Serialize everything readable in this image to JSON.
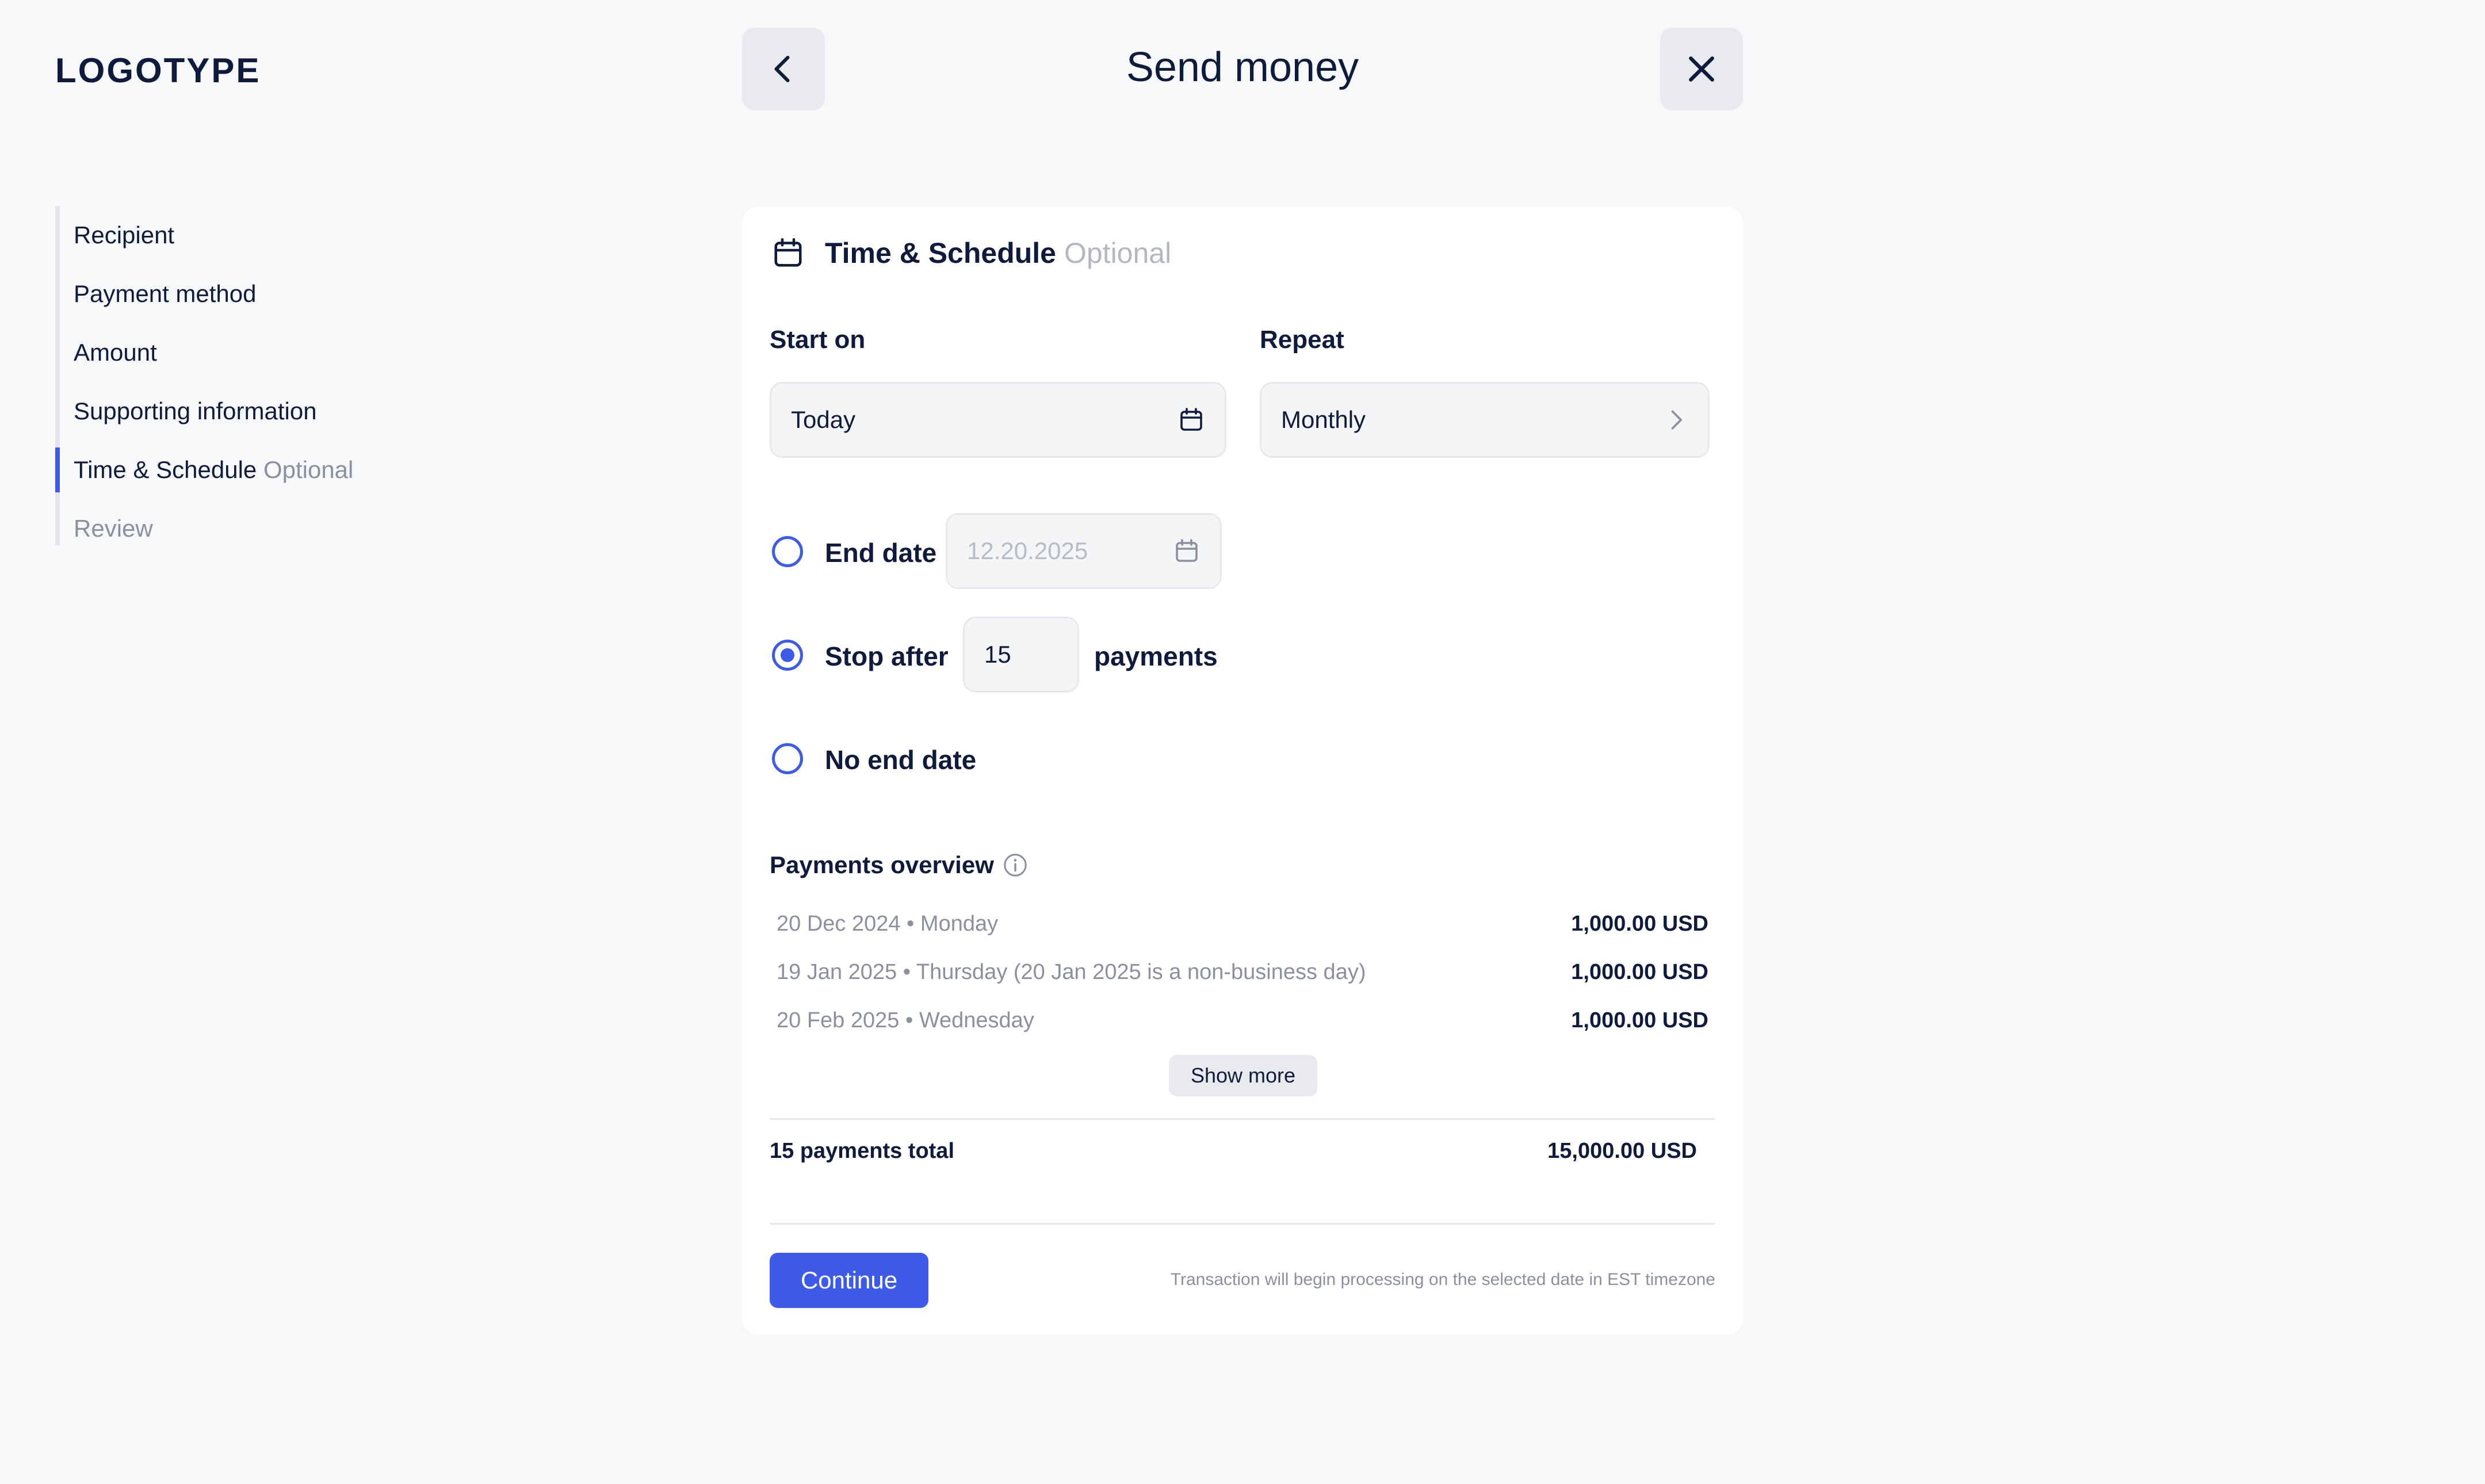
{
  "brand": {
    "logo": "LOGOTYPE"
  },
  "header": {
    "title": "Send money",
    "back_icon": "chevron-left-icon",
    "close_icon": "close-icon"
  },
  "steps": [
    {
      "label": "Recipient",
      "optional": ""
    },
    {
      "label": "Payment method",
      "optional": ""
    },
    {
      "label": "Amount",
      "optional": ""
    },
    {
      "label": "Supporting information",
      "optional": ""
    },
    {
      "label": "Time & Schedule",
      "optional": "Optional",
      "active": true
    },
    {
      "label": "Review",
      "optional": "",
      "muted": true
    }
  ],
  "section": {
    "title": "Time & Schedule",
    "optional": "Optional",
    "icon": "calendar-icon"
  },
  "start_on": {
    "label": "Start on",
    "value": "Today"
  },
  "repeat": {
    "label": "Repeat",
    "value": "Monthly"
  },
  "end_options": {
    "end_date": {
      "label": "End date",
      "placeholder": "12.20.2025",
      "checked": false
    },
    "stop_after": {
      "label": "Stop after",
      "value": "15",
      "suffix": "payments",
      "checked": true
    },
    "no_end": {
      "label": "No end date",
      "checked": false
    }
  },
  "overview": {
    "title": "Payments overview",
    "rows": [
      {
        "date": "20 Dec 2024 • Monday",
        "amount": "1,000.00 USD"
      },
      {
        "date": "19 Jan 2025 • Thursday (20 Jan 2025 is a non-business day)",
        "amount": "1,000.00 USD"
      },
      {
        "date": "20 Feb 2025 • Wednesday",
        "amount": "1,000.00 USD"
      }
    ],
    "show_more": "Show more",
    "total_label": "15 payments total",
    "total_amount": "15,000.00 USD"
  },
  "footer": {
    "continue": "Continue",
    "note": "Transaction will begin processing on the selected date in EST timezone"
  },
  "colors": {
    "accent": "#3d5ae8",
    "text": "#0f1b3d",
    "muted": "#8a90a0",
    "background": "#f7f8f9"
  }
}
